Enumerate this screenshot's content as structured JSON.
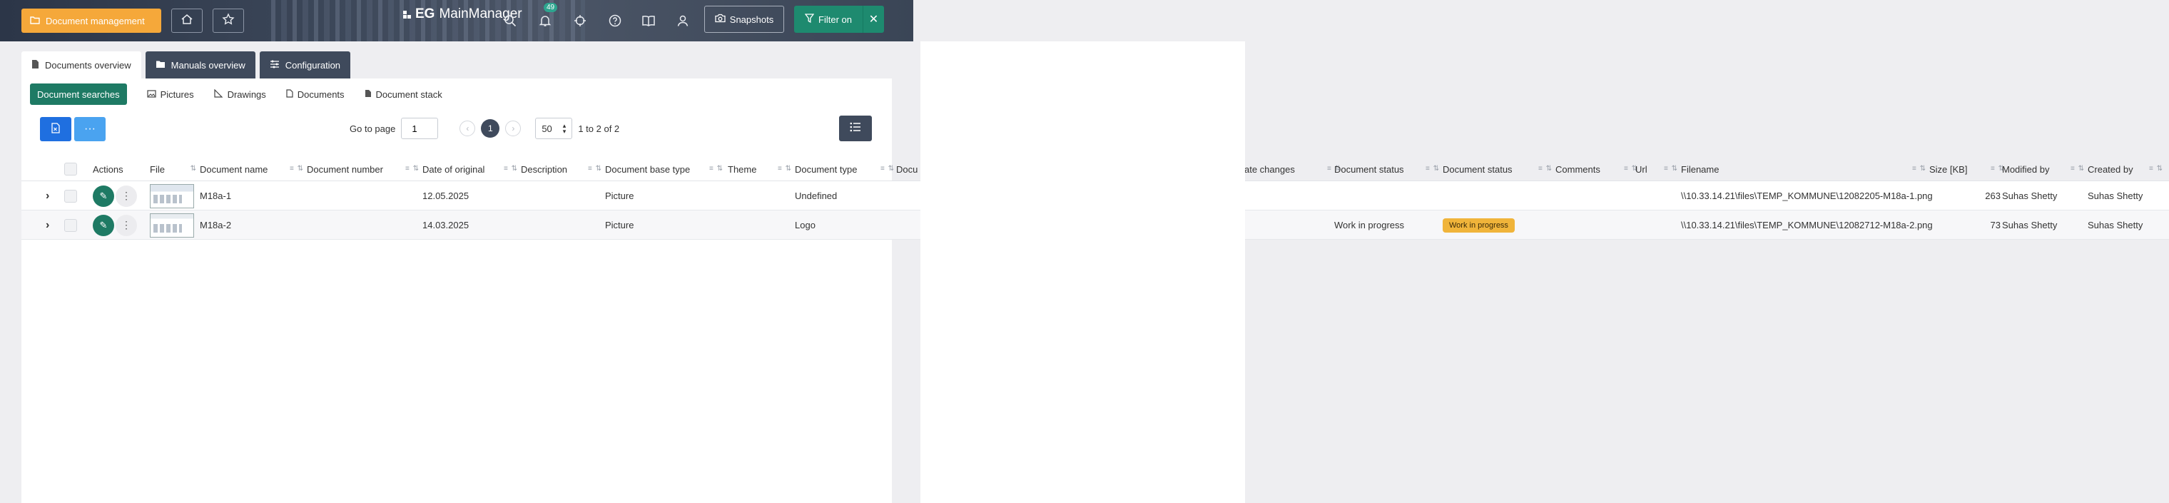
{
  "header": {
    "doc_mgmt_label": "Document management",
    "logo_eg": "EG",
    "logo_text": "MainManager",
    "notifications_count": "49",
    "snapshots_label": "Snapshots",
    "filter_label": "Filter on",
    "filter_clear": "✕"
  },
  "main_tabs": [
    {
      "label": "Documents overview"
    },
    {
      "label": "Manuals overview"
    },
    {
      "label": "Configuration"
    }
  ],
  "sub_tabs": [
    {
      "label": "Document searches"
    },
    {
      "label": "Pictures"
    },
    {
      "label": "Drawings"
    },
    {
      "label": "Documents"
    },
    {
      "label": "Document stack"
    }
  ],
  "toolbar": {
    "more_label": "···",
    "go_to_page_label": "Go to page",
    "page_input": "1",
    "current_page": "1",
    "page_size": "50",
    "range_text": "1 to 2 of 2"
  },
  "columns": {
    "actions": "Actions",
    "file": "File",
    "document_name": "Document name",
    "document_number": "Document number",
    "date_of_original": "Date of original",
    "description": "Description",
    "document_base_type": "Document base type",
    "theme": "Theme",
    "document_type": "Document type",
    "docu_partial": "Docu",
    "date_changes_partial": "ate changes",
    "document_status": "Document status",
    "document_status_2": "Document status",
    "comments": "Comments",
    "url": "Url",
    "filename": "Filename",
    "size_kb": "Size [KB]",
    "modified_by": "Modified by",
    "created_by": "Created by"
  },
  "rows": [
    {
      "document_name": "M18a-1",
      "date_of_original": "12.05.2025",
      "document_base_type": "Picture",
      "document_type": "Undefined",
      "document_status": "",
      "document_status_badge": "",
      "filename": "\\\\10.33.14.21\\files\\TEMP_KOMMUNE\\12082205-M18a-1.png",
      "size_kb": "263",
      "modified_by": "Suhas Shetty",
      "created_by": "Suhas Shetty"
    },
    {
      "document_name": "M18a-2",
      "date_of_original": "14.03.2025",
      "document_base_type": "Picture",
      "document_type": "Logo",
      "document_status": "Work in progress",
      "document_status_badge": "Work in progress",
      "filename": "\\\\10.33.14.21\\files\\TEMP_KOMMUNE\\12082712-M18a-2.png",
      "size_kb": "73",
      "modified_by": "Suhas Shetty",
      "created_by": "Suhas Shetty"
    }
  ],
  "colors": {
    "accent_orange": "#f5a83a",
    "accent_green": "#1e7a64",
    "header_dark": "#3f4a5c",
    "excel_blue": "#1f6fe0",
    "status_badge": "#f0b43a"
  }
}
